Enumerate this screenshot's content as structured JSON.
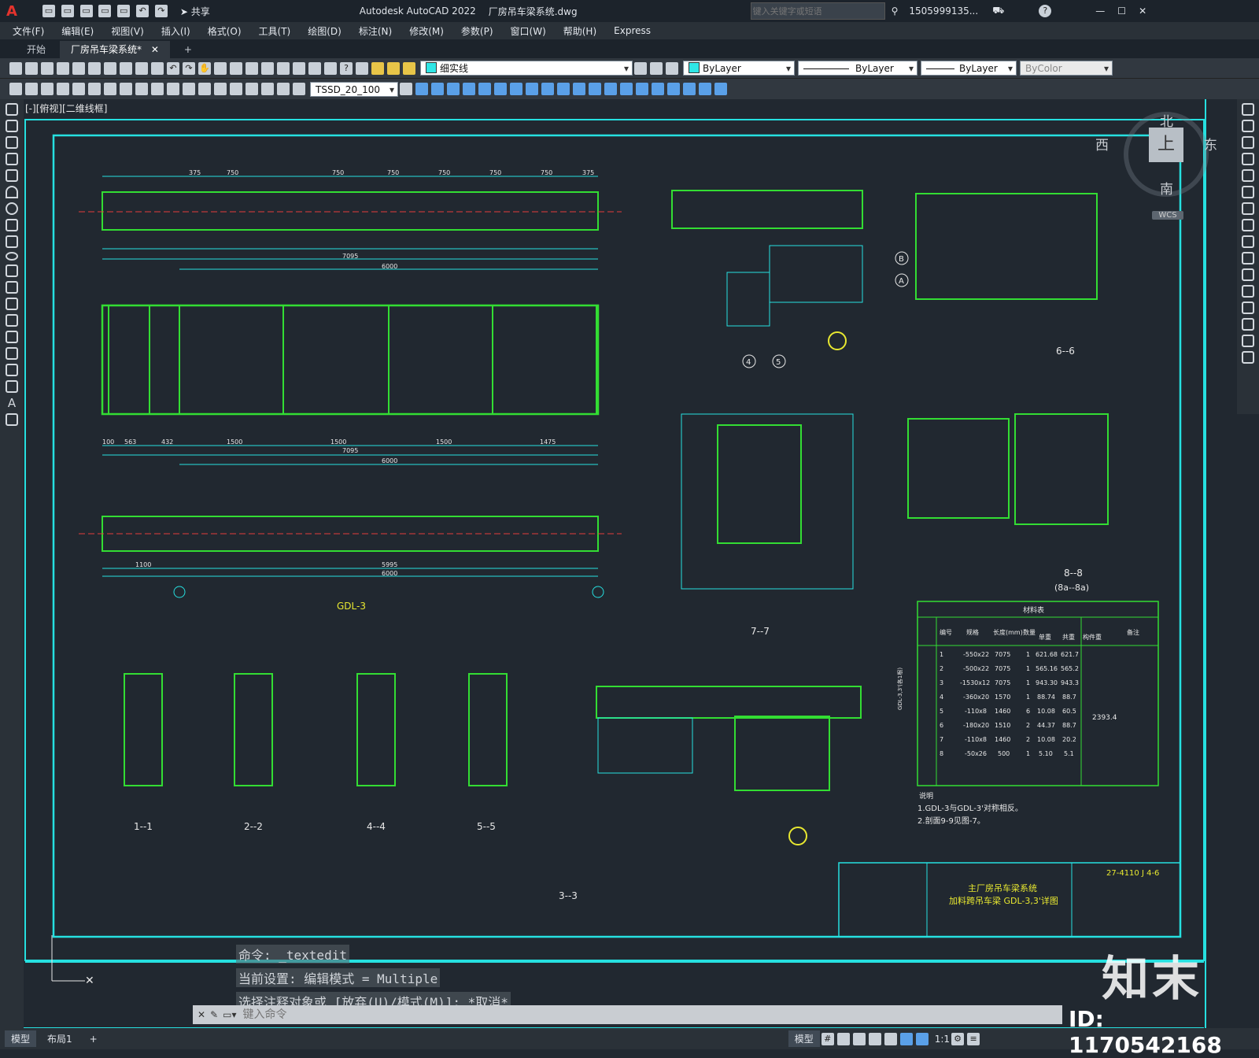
{
  "titlebar": {
    "logo": "A",
    "app_title": "Autodesk AutoCAD 2022",
    "file_name": "厂房吊车梁系统.dwg",
    "share_label": "共享",
    "search_placeholder": "键入关键字或短语",
    "user": "1505999135...",
    "help": "?"
  },
  "menu": [
    "文件(F)",
    "编辑(E)",
    "视图(V)",
    "插入(I)",
    "格式(O)",
    "工具(T)",
    "绘图(D)",
    "标注(N)",
    "修改(M)",
    "参数(P)",
    "窗口(W)",
    "帮助(H)",
    "Express"
  ],
  "tabs": {
    "start": "开始",
    "drawing": "厂房吊车梁系统*",
    "add": "+"
  },
  "toolbar": {
    "layer": "细实线",
    "color": "ByLayer",
    "linetype": "ByLayer",
    "lineweight": "ByLayer",
    "plotstyle": "ByColor",
    "dimstyle": "TSSD_20_100"
  },
  "viewport_label": "[-][俯视][二维线框]",
  "viewcube": {
    "north": "北",
    "south": "南",
    "east": "东",
    "west": "西",
    "top": "上",
    "wcs": "WCS"
  },
  "drawing": {
    "beam_name": "GDL-3",
    "dims_top": [
      "375",
      "750",
      "750",
      "750",
      "750",
      "750",
      "750",
      "375"
    ],
    "dims_plan": [
      "100",
      "563",
      "432",
      "1500",
      "1500",
      "1500",
      "1475"
    ],
    "dims_totals": [
      "7095",
      "6000",
      "5995",
      "1100"
    ],
    "sections": [
      "1--1",
      "2--2",
      "4--4",
      "5--5",
      "3--3",
      "7--7",
      "6--6",
      "8--8"
    ],
    "section_sub": "(8a--8a)",
    "axis_labels": [
      "A",
      "B",
      "4",
      "5"
    ],
    "notes_title": "说明",
    "notes": [
      "1.GDL-3与GDL-3'对称相反。",
      "2.剖面9-9见图-7。"
    ],
    "title_block": {
      "project": "主厂房吊车梁系统",
      "drawing": "加料跨吊车梁 GDL-3,3'详图",
      "number": "27-4110 J 4-6"
    }
  },
  "material_table": {
    "title": "材料表",
    "headers": [
      "编号",
      "规格",
      "长度(mm)",
      "数量",
      "单重",
      "共重",
      "构件重",
      "备注"
    ],
    "rows": [
      [
        "1",
        "-550x22",
        "7075",
        "1",
        "621.68",
        "621.7"
      ],
      [
        "2",
        "-500x22",
        "7075",
        "1",
        "565.16",
        "565.2"
      ],
      [
        "3",
        "-1530x12",
        "7075",
        "1",
        "943.30",
        "943.3"
      ],
      [
        "4",
        "-360x20",
        "1570",
        "1",
        "88.74",
        "88.7"
      ],
      [
        "5",
        "-110x8",
        "1460",
        "6",
        "10.08",
        "60.5"
      ],
      [
        "6",
        "-180x20",
        "1510",
        "2",
        "44.37",
        "88.7"
      ],
      [
        "7",
        "-110x8",
        "1460",
        "2",
        "10.08",
        "20.2"
      ],
      [
        "8",
        "-50x26",
        "500",
        "1",
        "5.10",
        "5.1"
      ]
    ],
    "total": "2393.4",
    "member": "GDL-3,3'(各1根)"
  },
  "command": {
    "history": [
      "命令: _textedit",
      "当前设置: 编辑模式 = Multiple",
      "选择注释对象或 [放弃(U)/模式(M)]: *取消*"
    ],
    "placeholder": "键入命令"
  },
  "status": {
    "model_tab": "模型",
    "layout_tab": "布局1",
    "add": "+",
    "model_btn": "模型",
    "scale": "1:1"
  },
  "watermark": {
    "brand": "知末",
    "id": "ID: 1170542168"
  }
}
